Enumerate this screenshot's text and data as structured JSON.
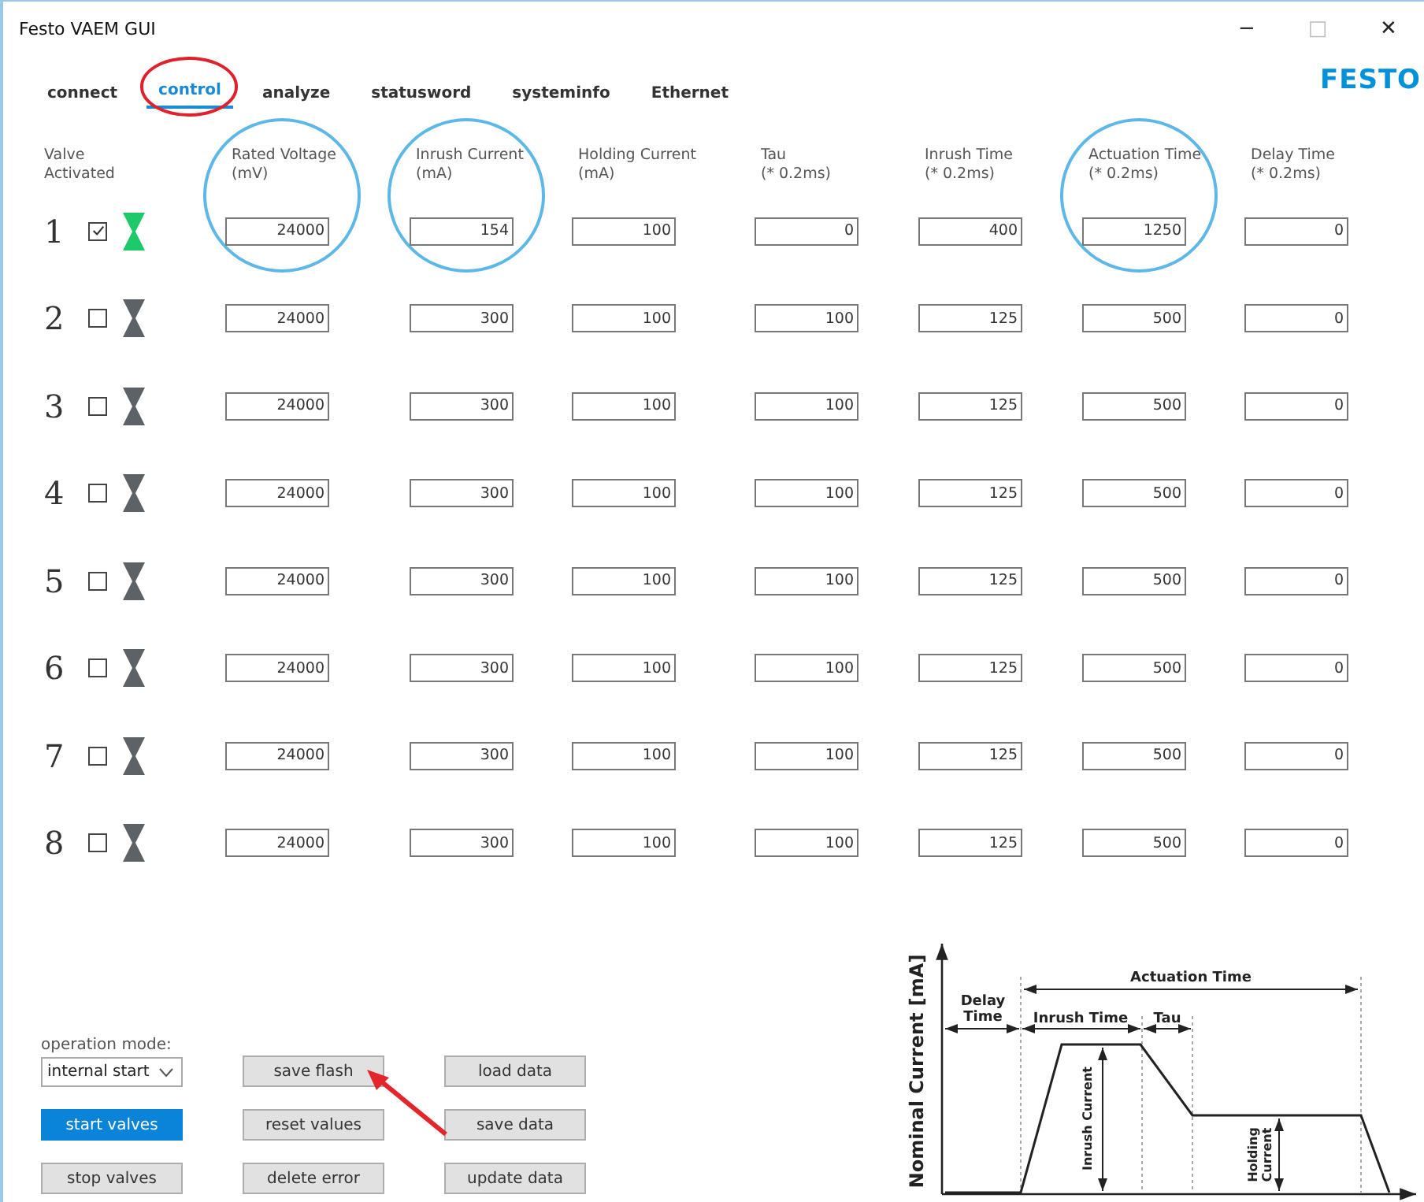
{
  "window": {
    "title": "Festo VAEM GUI",
    "controls": [
      "−",
      "□",
      "✕"
    ]
  },
  "tabs": [
    {
      "label": "connect",
      "selected": false,
      "circled": false
    },
    {
      "label": "control",
      "selected": true,
      "circled": true
    },
    {
      "label": "analyze",
      "selected": false,
      "circled": false
    },
    {
      "label": "statusword",
      "selected": false,
      "circled": false
    },
    {
      "label": "systeminfo",
      "selected": false,
      "circled": false
    },
    {
      "label": "Ethernet",
      "selected": false,
      "circled": false
    }
  ],
  "logo": "FESTO",
  "table": {
    "first_header": [
      "Valve",
      "Activated"
    ],
    "columns": [
      {
        "label": "Rated Voltage",
        "unit": "(mV)",
        "circled": true
      },
      {
        "label": "Inrush Current",
        "unit": "(mA)",
        "circled": true
      },
      {
        "label": "Holding Current",
        "unit": "(mA)",
        "circled": false
      },
      {
        "label": "Tau",
        "unit": "(* 0.2ms)",
        "circled": false
      },
      {
        "label": "Inrush Time",
        "unit": "(* 0.2ms)",
        "circled": false
      },
      {
        "label": "Actuation Time",
        "unit": "(* 0.2ms)",
        "circled": true
      },
      {
        "label": "Delay Time",
        "unit": "(* 0.2ms)",
        "circled": false
      }
    ],
    "rows": [
      {
        "number": "1",
        "checked": true,
        "active": true,
        "values": [
          "24000",
          "154",
          "100",
          "0",
          "400",
          "1250",
          "0"
        ]
      },
      {
        "number": "2",
        "checked": false,
        "active": false,
        "values": [
          "24000",
          "300",
          "100",
          "100",
          "125",
          "500",
          "0"
        ]
      },
      {
        "number": "3",
        "checked": false,
        "active": false,
        "values": [
          "24000",
          "300",
          "100",
          "100",
          "125",
          "500",
          "0"
        ]
      },
      {
        "number": "4",
        "checked": false,
        "active": false,
        "values": [
          "24000",
          "300",
          "100",
          "100",
          "125",
          "500",
          "0"
        ]
      },
      {
        "number": "5",
        "checked": false,
        "active": false,
        "values": [
          "24000",
          "300",
          "100",
          "100",
          "125",
          "500",
          "0"
        ]
      },
      {
        "number": "6",
        "checked": false,
        "active": false,
        "values": [
          "24000",
          "300",
          "100",
          "100",
          "125",
          "500",
          "0"
        ]
      },
      {
        "number": "7",
        "checked": false,
        "active": false,
        "values": [
          "24000",
          "300",
          "100",
          "100",
          "125",
          "500",
          "0"
        ]
      },
      {
        "number": "8",
        "checked": false,
        "active": false,
        "values": [
          "24000",
          "300",
          "100",
          "100",
          "125",
          "500",
          "0"
        ]
      }
    ]
  },
  "operation_mode": {
    "label": "operation mode:",
    "value": "internal start"
  },
  "buttons": [
    [
      {
        "label": "start valves",
        "selected": true
      },
      {
        "label": "stop valves",
        "selected": false
      }
    ],
    [
      {
        "label": "save flash",
        "selected": false
      },
      {
        "label": "reset values",
        "selected": false
      },
      {
        "label": "delete error",
        "selected": false
      }
    ],
    [
      {
        "label": "load data",
        "selected": false
      },
      {
        "label": "save data",
        "selected": false
      },
      {
        "label": "update data",
        "selected": false
      }
    ]
  ],
  "annotation_arrow": true,
  "diagram": {
    "y_axis": "Nominal Current [mA]",
    "actuation_time": "Actuation Time",
    "delay_time": [
      "Delay",
      "Time"
    ],
    "inrush_time": "Inrush Time",
    "tau": "Tau",
    "inrush_current": "Inrush Current",
    "holding_current": [
      "Holding",
      "Current"
    ]
  }
}
